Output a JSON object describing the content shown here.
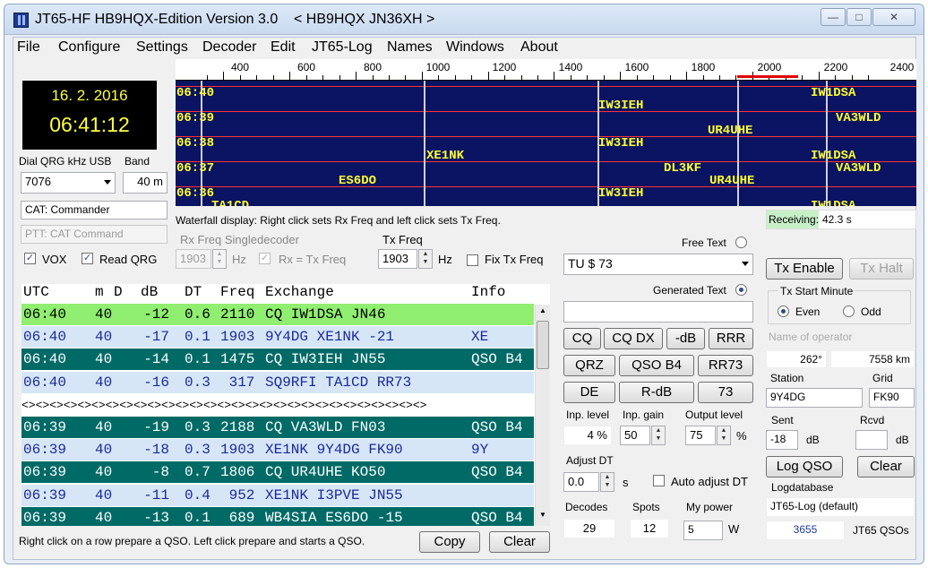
{
  "window": {
    "title": "JT65-HF HB9HQX-Edition Version 3.0    < HB9HQX JN36XH >"
  },
  "menu": [
    "File",
    "Configure",
    "Settings",
    "Decoder",
    "Edit",
    "JT65-Log",
    "Names",
    "Windows",
    "About"
  ],
  "clock": {
    "date": "16. 2. 2016",
    "time": "06:41:12"
  },
  "dial": {
    "label": "Dial QRG kHz USB",
    "value": "7076"
  },
  "band": {
    "label": "Band",
    "value": "40 m"
  },
  "cat": {
    "value": "CAT: Commander"
  },
  "ptt": {
    "value": "PTT: CAT Command"
  },
  "vox": {
    "label": "VOX",
    "checked": true
  },
  "readqrg": {
    "label": "Read QRG",
    "checked": true
  },
  "waterfall": {
    "ticks": [
      "400",
      "600",
      "800",
      "1000",
      "1200",
      "1400",
      "1600",
      "1800",
      "2000",
      "2200",
      "2400"
    ],
    "times": [
      "06:40",
      "06:39",
      "06:38",
      "06:37",
      "06:36"
    ],
    "calls": [
      {
        "text": "IW1DSA",
        "row": 0
      },
      {
        "text": "IW3IEH",
        "row": 0
      },
      {
        "text": "VA3WLD",
        "row": 1
      },
      {
        "text": "UR4UHE",
        "row": 1
      },
      {
        "text": "IW3IEH",
        "row": 2
      },
      {
        "text": "XE1NK",
        "row": 2
      },
      {
        "text": "IW1DSA",
        "row": 2
      },
      {
        "text": "DL3KF",
        "row": 3
      },
      {
        "text": "VA3WLD",
        "row": 3
      },
      {
        "text": "ES6DO",
        "row": 3
      },
      {
        "text": "UR4UHE",
        "row": 3
      },
      {
        "text": "IW3IEH",
        "row": 4
      },
      {
        "text": "TA1CD",
        "row": 4
      },
      {
        "text": "IW1DSA",
        "row": 4
      }
    ],
    "hint": "Waterfall display: Right click sets Rx Freq and left click sets Tx Freq."
  },
  "receiving": {
    "label": "Receiving:",
    "value": "42.3 s"
  },
  "rxfreq": {
    "label": "Rx Freq Singledecoder",
    "value": "1903",
    "unit": "Hz",
    "rx_eq_tx": "Rx = Tx Freq"
  },
  "txfreq": {
    "label": "Tx Freq",
    "value": "1903",
    "unit": "Hz",
    "fix": "Fix Tx Freq"
  },
  "freetext": {
    "label": "Free Text",
    "value": "TU $ 73"
  },
  "generated": {
    "label": "Generated Text",
    "value": ""
  },
  "table": {
    "headers": {
      "utc": "UTC",
      "m": "m",
      "d": "D",
      "db": "dB",
      "dt": "DT",
      "freq": "Freq",
      "exchange": "Exchange",
      "info": "Info"
    },
    "rows": [
      {
        "utc": "06:40",
        "m": "40",
        "db": "-12",
        "dt": "0.6",
        "freq": "2110",
        "ex": "CQ IW1DSA JN46",
        "info": "",
        "style": "green"
      },
      {
        "utc": "06:40",
        "m": "40",
        "db": "-17",
        "dt": "0.1",
        "freq": "1903",
        "ex": "9Y4DG XE1NK -21",
        "info": "XE",
        "style": "light"
      },
      {
        "utc": "06:40",
        "m": "40",
        "db": "-14",
        "dt": "0.1",
        "freq": "1475",
        "ex": "CQ IW3IEH JN55",
        "info": "QSO B4",
        "style": "teal"
      },
      {
        "utc": "06:40",
        "m": "40",
        "db": "-16",
        "dt": "0.3",
        "freq": " 317",
        "ex": "SQ9RFI TA1CD RR73",
        "info": "",
        "style": "light"
      },
      {
        "utc": "",
        "m": "",
        "db": "",
        "dt": "",
        "freq": "",
        "ex": "",
        "info": "",
        "style": "sep"
      },
      {
        "utc": "06:39",
        "m": "40",
        "db": "-19",
        "dt": "0.3",
        "freq": "2188",
        "ex": "CQ VA3WLD FN03",
        "info": "QSO B4",
        "style": "teal"
      },
      {
        "utc": "06:39",
        "m": "40",
        "db": "-18",
        "dt": "0.3",
        "freq": "1903",
        "ex": "XE1NK 9Y4DG FK90",
        "info": "9Y",
        "style": "light"
      },
      {
        "utc": "06:39",
        "m": "40",
        "db": "-8",
        "dt": "0.7",
        "freq": "1806",
        "ex": "CQ UR4UHE KO50",
        "info": "QSO B4",
        "style": "teal"
      },
      {
        "utc": "06:39",
        "m": "40",
        "db": "-11",
        "dt": "0.4",
        "freq": " 952",
        "ex": "XE1NK I3PVE JN55",
        "info": "",
        "style": "light"
      },
      {
        "utc": "06:39",
        "m": "40",
        "db": "-13",
        "dt": "0.1",
        "freq": " 689",
        "ex": "WB4SIA ES6DO -15",
        "info": "QSO B4",
        "style": "teal"
      }
    ],
    "separator": "<><><><><><><><><><><><><><><><><><><><><><><><><><><><><>",
    "hint": "Right click on a row prepare a QSO. Left click prepare and starts a QSO."
  },
  "buttons": {
    "copy": "Copy",
    "clear": "Clear",
    "cq": "CQ",
    "cqdx": "CQ DX",
    "mdb": "-dB",
    "rrr": "RRR",
    "qrz": "QRZ",
    "qsob4": "QSO B4",
    "rr73": "RR73",
    "de": "DE",
    "rdb": "R-dB",
    "s73": "73",
    "txenable": "Tx Enable",
    "txhalt": "Tx Halt",
    "logqso": "Log QSO",
    "clear2": "Clear"
  },
  "levels": {
    "inp_label": "Inp. level",
    "inp": "4 %",
    "gain_label": "Inp. gain",
    "gain": "50",
    "out_label": "Output level",
    "out": "75",
    "out_unit": "%"
  },
  "adjustdt": {
    "label": "Adjust DT",
    "value": "0.0",
    "unit": "s",
    "auto": "Auto adjust DT"
  },
  "stats": {
    "decodes_label": "Decodes",
    "decodes": "29",
    "spots_label": "Spots",
    "spots": "12",
    "power_label": "My power",
    "power": "5",
    "power_unit": "W"
  },
  "txstart": {
    "label": "Tx Start Minute",
    "even": "Even",
    "odd": "Odd"
  },
  "operator": {
    "placeholder": "Name of operator"
  },
  "bearing": {
    "deg": "262°",
    "km": "7558 km"
  },
  "station": {
    "label": "Station",
    "value": "9Y4DG",
    "grid_label": "Grid",
    "grid": "FK90"
  },
  "report": {
    "sent_label": "Sent",
    "sent": "-18",
    "sent_unit": "dB",
    "rcvd_label": "Rcvd",
    "rcvd": "",
    "rcvd_unit": "dB"
  },
  "logdb": {
    "label": "Logdatabase",
    "value": "JT65-Log (default)",
    "count": "3655",
    "count_label": "JT65 QSOs"
  },
  "colors": {
    "green": "#90ee70",
    "teal": "#006a66",
    "light": "#d6e6f6"
  }
}
